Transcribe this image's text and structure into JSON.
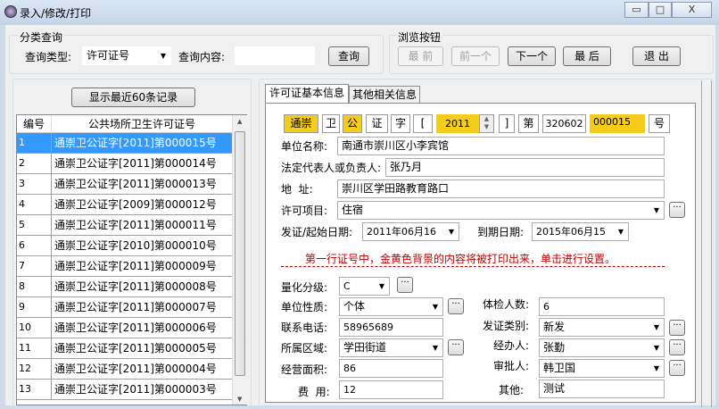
{
  "window": {
    "title": "录入/修改/打印",
    "min": "▭",
    "max": "□",
    "close": "X"
  },
  "search": {
    "group_label": "分类查询",
    "type_label": "查询类型:",
    "type_value": "许可证号",
    "content_label": "查询内容:",
    "content_value": "",
    "query_button": "查询"
  },
  "browse": {
    "group_label": "浏览按钮",
    "first": "最 前",
    "prev": "前一个",
    "next": "下一个",
    "last": "最 后",
    "exit": "退 出"
  },
  "recent_button": "显示最近60条记录",
  "table": {
    "headers": [
      "编号",
      "公共场所卫生许可证号"
    ],
    "rows": [
      [
        "1",
        "通崇卫公证字[2011]第000015号"
      ],
      [
        "2",
        "通崇卫公证字[2011]第000014号"
      ],
      [
        "3",
        "通崇卫公证字[2011]第000013号"
      ],
      [
        "4",
        "通崇卫公证字[2009]第000012号"
      ],
      [
        "5",
        "通崇卫公证字[2011]第000011号"
      ],
      [
        "6",
        "通崇卫公证字[2010]第000010号"
      ],
      [
        "7",
        "通崇卫公证字[2011]第000009号"
      ],
      [
        "8",
        "通崇卫公证字[2011]第000008号"
      ],
      [
        "9",
        "通崇卫公证字[2011]第000007号"
      ],
      [
        "10",
        "通崇卫公证字[2011]第000006号"
      ],
      [
        "11",
        "通崇卫公证字[2011]第000005号"
      ],
      [
        "12",
        "通崇卫公证字[2011]第000004号"
      ],
      [
        "13",
        "通崇卫公证字[2011]第000003号"
      ]
    ]
  },
  "tabs": [
    "许可证基本信息",
    "其他相关信息"
  ],
  "license": {
    "p1": "通崇",
    "p2": "卫",
    "p3": "公",
    "p4": "证",
    "p5": "字",
    "p6": "[",
    "year": "2011",
    "p7": "]",
    "p8": "第",
    "code": "320602",
    "serial": "000015",
    "p9": "号"
  },
  "form": {
    "unit_name_label": "单位名称:",
    "unit_name": "南通市崇川区小李宾馆",
    "rep_label": "法定代表人或负责人:",
    "rep": "张乃月",
    "addr_label": "地  址:",
    "addr": "崇川区学田路教育路口",
    "item_label": "许可项目:",
    "item": "住宿",
    "start_label": "发证/起始日期:",
    "start": "2011年06月16",
    "end_label": "到期日期:",
    "end": "2015年06月15",
    "note": "第一行证号中，金黄色背景的内容将被打印出来，单击进行设置。",
    "grade_label": "量化分级:",
    "grade": "C",
    "nature_label": "单位性质:",
    "nature": "个体",
    "phone_label": "联系电话:",
    "phone": "58965689",
    "area_label": "所属区域:",
    "area": "学田街道",
    "size_label": "经营面积:",
    "size": "86",
    "fee_label": "费  用:",
    "fee": "12",
    "exam_label": "体检人数:",
    "exam": "6",
    "issue_type_label": "发证类别:",
    "issue_type": "新发",
    "handler_label": "经办人:",
    "handler": "张勤",
    "approver_label": "审批人:",
    "approver": "韩卫国",
    "other_label": "其他:",
    "other": "测试"
  },
  "colors": {
    "gold": "#f5cc1a",
    "selection": "#3399ff",
    "note": "#c00000"
  }
}
